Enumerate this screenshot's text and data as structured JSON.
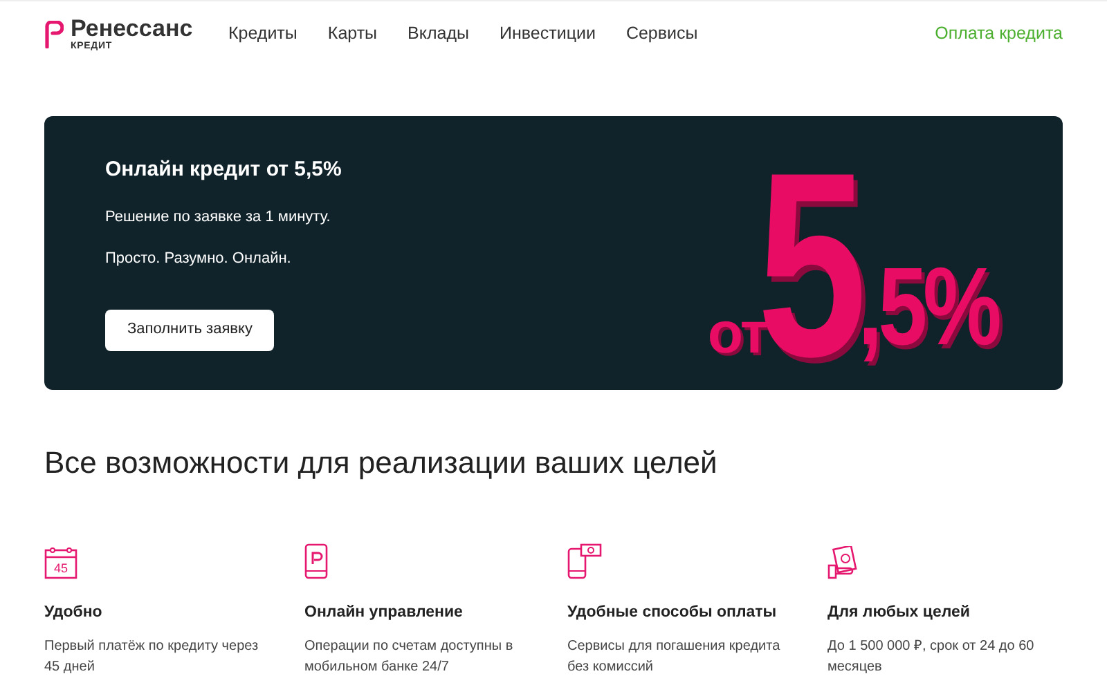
{
  "header": {
    "logo": {
      "name": "Ренессанс",
      "sub": "КРЕДИТ"
    },
    "nav": [
      "Кредиты",
      "Карты",
      "Вклады",
      "Инвестиции",
      "Сервисы"
    ],
    "action": "Оплата кредита"
  },
  "banner": {
    "title": "Онлайн кредит от 5,5%",
    "lines": [
      "Решение по заявке за 1 минуту.",
      "Просто. Разумно. Онлайн."
    ],
    "button": "Заполнить заявку",
    "promo": {
      "prefix": "от",
      "big": "5",
      "rest": ",5%"
    }
  },
  "section": {
    "title": "Все возможности для реализации ваших целей",
    "features": [
      {
        "kind": "calendar",
        "badge": "45",
        "title": "Удобно",
        "text": "Первый платёж по кредиту через 45 дней"
      },
      {
        "kind": "phone",
        "title": "Онлайн управление",
        "text": "Операции по счетам доступны в мобильном банке 24/7"
      },
      {
        "kind": "payment",
        "title": "Удобные способы оплаты",
        "text": "Сервисы для погашения кредита без комиссий"
      },
      {
        "kind": "cash",
        "title": "Для любых целей",
        "text": "До 1 500 000 ₽, срок от 24 до 60 месяцев"
      }
    ]
  }
}
